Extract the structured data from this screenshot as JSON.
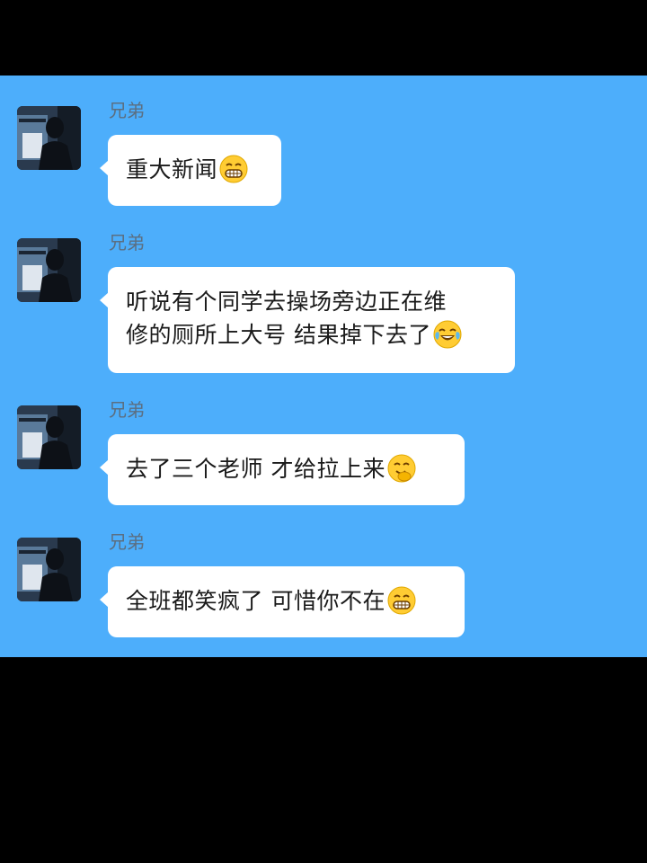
{
  "chat": {
    "background_color": "#4daefb",
    "messages": [
      {
        "sender": "兄弟",
        "text": "重大新闻",
        "emoji": "grin-emoji"
      },
      {
        "sender": "兄弟",
        "text_line1": "听说有个同学去操场旁边正在维",
        "text_line2": "修的厕所上大号 结果掉下去了",
        "emoji": "tears-of-joy-emoji"
      },
      {
        "sender": "兄弟",
        "text": "去了三个老师 才给拉上来",
        "emoji": "giggle-emoji"
      },
      {
        "sender": "兄弟",
        "text": "全班都笑疯了 可惜你不在",
        "emoji": "grin-emoji"
      }
    ]
  }
}
